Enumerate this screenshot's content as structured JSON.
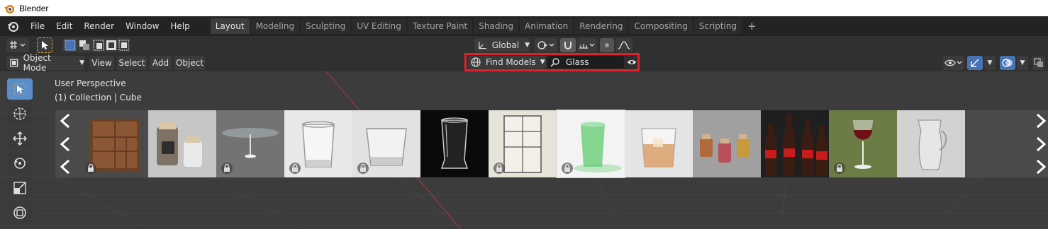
{
  "window": {
    "title": "Blender"
  },
  "menu": [
    "File",
    "Edit",
    "Render",
    "Window",
    "Help"
  ],
  "workspace_tabs": [
    "Layout",
    "Modeling",
    "Sculpting",
    "UV Editing",
    "Texture Paint",
    "Shading",
    "Animation",
    "Rendering",
    "Compositing",
    "Scripting"
  ],
  "active_tab": "Layout",
  "tool_settings": {
    "transform_orientation": "Global"
  },
  "view_header": {
    "mode": "Object Mode",
    "menus": [
      "View",
      "Select",
      "Add",
      "Object"
    ]
  },
  "find_models": {
    "label": "Find Models",
    "search_value": "Glass"
  },
  "viewport": {
    "perspective": "User Perspective",
    "collection": "(1) Collection | Cube"
  },
  "models": [
    {
      "name": "wooden-cabinet",
      "locked": true
    },
    {
      "name": "spice-jars",
      "locked": false
    },
    {
      "name": "glass-table",
      "locked": true
    },
    {
      "name": "glass-tumbler",
      "locked": true
    },
    {
      "name": "square-glass",
      "locked": true
    },
    {
      "name": "shot-glass-dark",
      "locked": false
    },
    {
      "name": "window-frame",
      "locked": true
    },
    {
      "name": "green-glass",
      "locked": true
    },
    {
      "name": "whisky-glass",
      "locked": false
    },
    {
      "name": "small-jars",
      "locked": false
    },
    {
      "name": "cola-bottles",
      "locked": false
    },
    {
      "name": "wine-glass",
      "locked": true
    },
    {
      "name": "glass-jug",
      "locked": false
    }
  ],
  "colors": {
    "accent": "#5a8ecb",
    "highlight": "#e2202b"
  }
}
